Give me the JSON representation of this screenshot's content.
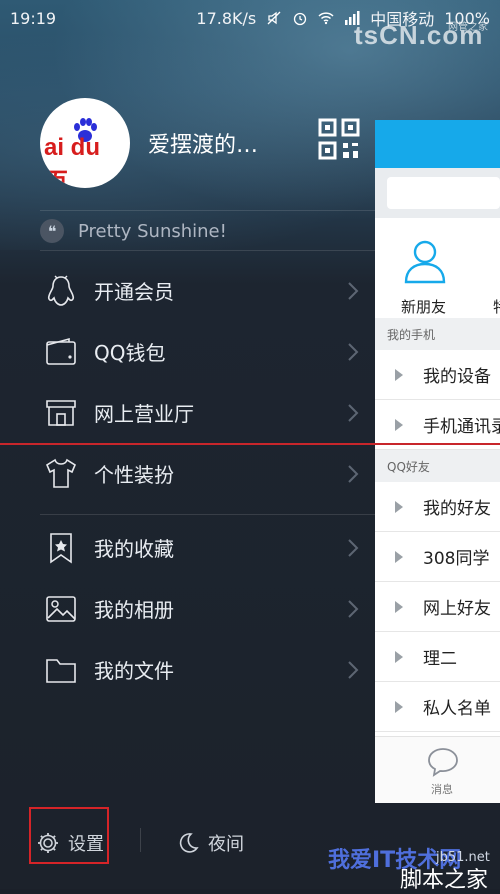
{
  "status_bar": {
    "time": "19:19",
    "net_speed": "17.8K/s",
    "carrier": "中国移动",
    "battery": "100%"
  },
  "profile": {
    "nickname": "爱摆渡的…",
    "avatar_brand": "ai du 百",
    "signature": "Pretty Sunshine!"
  },
  "menu": {
    "items": [
      {
        "label": "开通会员",
        "icon": "penguin-icon"
      },
      {
        "label": "QQ钱包",
        "icon": "wallet-icon"
      },
      {
        "label": "网上营业厅",
        "icon": "store-icon"
      },
      {
        "label": "个性装扮",
        "icon": "tshirt-icon"
      },
      {
        "label": "我的收藏",
        "icon": "bookmark-star-icon"
      },
      {
        "label": "我的相册",
        "icon": "photo-icon"
      },
      {
        "label": "我的文件",
        "icon": "folder-icon"
      }
    ]
  },
  "bottom": {
    "settings_label": "设置",
    "night_label": "夜间"
  },
  "right_panel": {
    "quick_new_friend": "新朋友",
    "quick_next": "特",
    "section_phone": "我的手机",
    "phone_rows": [
      "我的设备",
      "手机通讯录"
    ],
    "section_friends": "QQ好友",
    "friend_rows": [
      "我的好友",
      "308同学",
      "网上好友",
      "理二",
      "私人名单"
    ],
    "tab_messages": "消息"
  },
  "watermarks": {
    "top": "tsCN.com",
    "top_small": "网管之家",
    "bottom_blue": "我爱IT技术网",
    "bottom_url": "jb51.net",
    "bottom_white": "脚本之家"
  },
  "colors": {
    "accent_blue": "#16a9ea",
    "highlight_red": "#d52428"
  }
}
